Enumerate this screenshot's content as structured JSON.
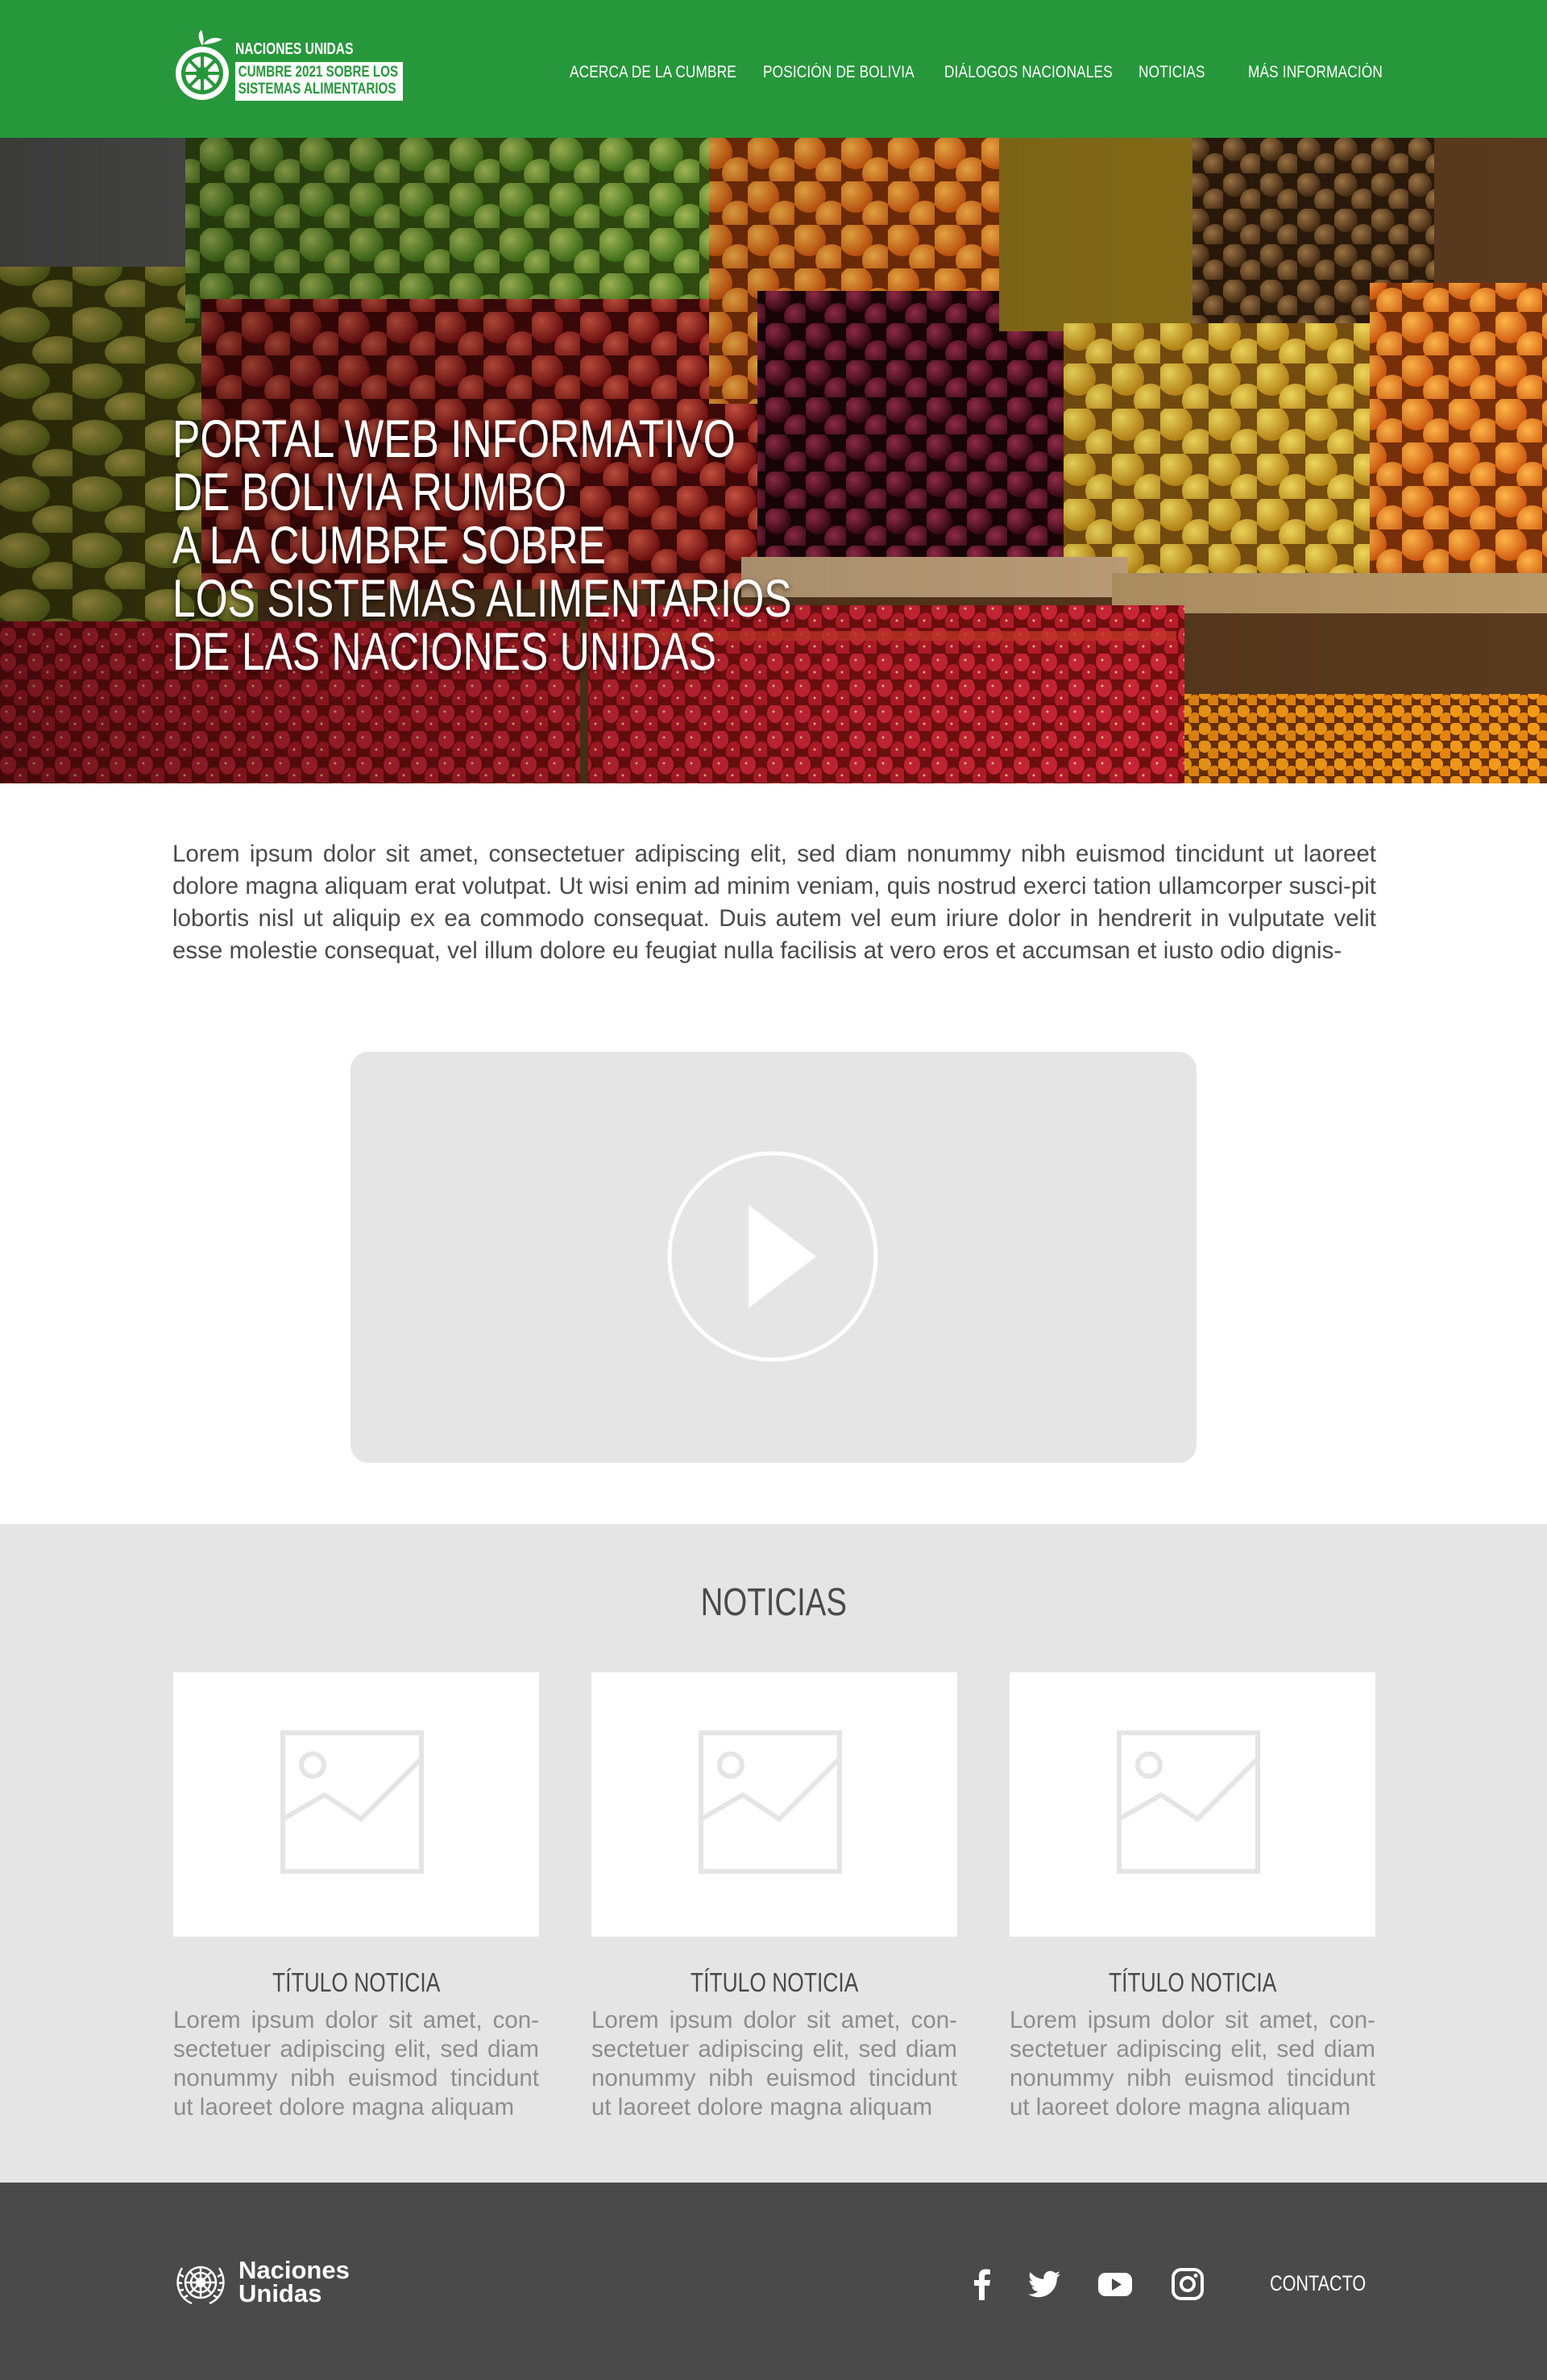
{
  "header": {
    "logo": {
      "line1": "NACIONES UNIDAS",
      "line2": "CUMBRE 2021 SOBRE LOS",
      "line3": "SISTEMAS ALIMENTARIOS"
    },
    "nav": [
      "ACERCA DE LA CUMBRE",
      "POSICIÓN DE BOLIVIA",
      "DIÁLOGOS NACIONALES",
      "NOTICIAS",
      "MÁS INFORMACIÓN"
    ]
  },
  "hero": {
    "title_lines": [
      "PORTAL WEB INFORMATIVO",
      "DE BOLIVIA RUMBO",
      "A LA CUMBRE SOBRE",
      "LOS SISTEMAS ALIMENTARIOS",
      "DE LAS NACIONES UNIDAS"
    ]
  },
  "intro": {
    "text": "Lorem ipsum dolor sit amet, consectetuer adipiscing elit, sed diam nonummy nibh euismod tincidunt ut laoreet dolore magna aliquam erat volutpat. Ut wisi enim ad minim veniam, quis nostrud exerci tation ullamcorper susci-pit lobortis nisl ut aliquip ex ea commodo consequat. Duis autem vel eum iriure dolor in hendrerit in vulputate velit esse molestie consequat, vel illum dolore eu feugiat nulla facilisis at vero eros et accumsan et iusto odio dignis-"
  },
  "video": {
    "icon": "play-icon"
  },
  "news": {
    "title": "NOTICIAS",
    "cards": [
      {
        "title": "TÍTULO NOTICIA",
        "text": "Lorem ipsum dolor sit amet, con-sectetuer adipiscing elit, sed diam nonummy nibh euismod tincidunt ut laoreet dolore magna aliquam"
      },
      {
        "title": "TÍTULO NOTICIA",
        "text": "Lorem ipsum dolor sit amet, con-sectetuer adipiscing elit, sed diam nonummy nibh euismod tincidunt ut laoreet dolore magna aliquam"
      },
      {
        "title": "TÍTULO NOTICIA",
        "text": "Lorem ipsum dolor sit amet, con-sectetuer adipiscing elit, sed diam nonummy nibh euismod tincidunt ut laoreet dolore magna aliquam"
      }
    ]
  },
  "footer": {
    "un_line1": "Naciones",
    "un_line2": "Unidas",
    "social": [
      "facebook-icon",
      "twitter-icon",
      "youtube-icon",
      "instagram-icon"
    ],
    "contact": "CONTACTO"
  },
  "colors": {
    "brand_green": "#27973c",
    "footer_gray": "#4a4a4a",
    "section_gray": "#e5e5e5"
  }
}
